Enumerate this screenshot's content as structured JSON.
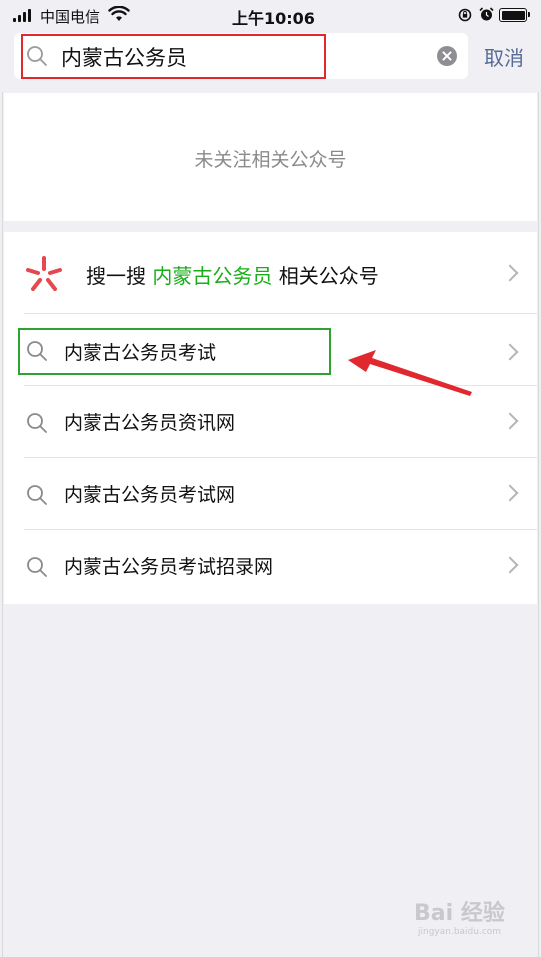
{
  "status_bar": {
    "carrier": "中国电信",
    "time": "上午10:06"
  },
  "search": {
    "query": "内蒙古公务员",
    "cancel_label": "取消"
  },
  "empty_state": {
    "message": "未关注相关公众号"
  },
  "sousou": {
    "prefix": "搜一搜",
    "keyword": "内蒙古公务员",
    "suffix": "相关公众号"
  },
  "suggestions": [
    {
      "label": "内蒙古公务员考试"
    },
    {
      "label": "内蒙古公务员资讯网"
    },
    {
      "label": "内蒙古公务员考试网"
    },
    {
      "label": "内蒙古公务员考试招录网"
    }
  ],
  "annotations": {
    "search_box_outline_color": "#e0282e",
    "first_suggestion_outline_color": "#2fa32f",
    "arrow_color": "#e0282e"
  },
  "watermark": {
    "main": "Bai 经验",
    "sub": "jingyan.baidu.com"
  },
  "colors": {
    "keyword_green": "#1aad19",
    "cancel_blue": "#576b95",
    "background": "#efeff4"
  }
}
